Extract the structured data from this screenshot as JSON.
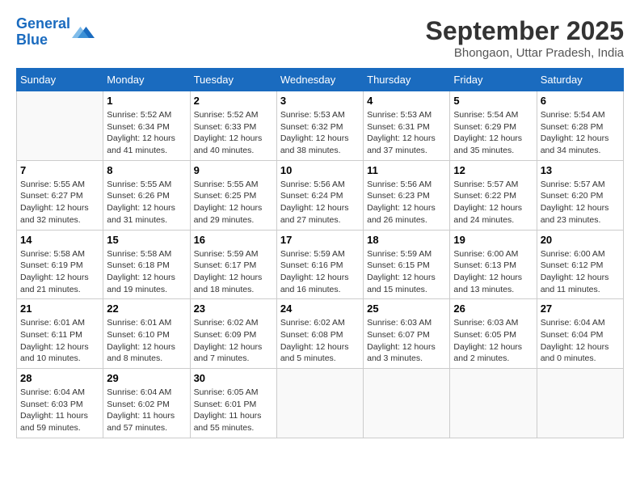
{
  "header": {
    "logo_line1": "General",
    "logo_line2": "Blue",
    "month": "September 2025",
    "location": "Bhongaon, Uttar Pradesh, India"
  },
  "days_of_week": [
    "Sunday",
    "Monday",
    "Tuesday",
    "Wednesday",
    "Thursday",
    "Friday",
    "Saturday"
  ],
  "weeks": [
    [
      {
        "day": "",
        "info": ""
      },
      {
        "day": "1",
        "info": "Sunrise: 5:52 AM\nSunset: 6:34 PM\nDaylight: 12 hours\nand 41 minutes."
      },
      {
        "day": "2",
        "info": "Sunrise: 5:52 AM\nSunset: 6:33 PM\nDaylight: 12 hours\nand 40 minutes."
      },
      {
        "day": "3",
        "info": "Sunrise: 5:53 AM\nSunset: 6:32 PM\nDaylight: 12 hours\nand 38 minutes."
      },
      {
        "day": "4",
        "info": "Sunrise: 5:53 AM\nSunset: 6:31 PM\nDaylight: 12 hours\nand 37 minutes."
      },
      {
        "day": "5",
        "info": "Sunrise: 5:54 AM\nSunset: 6:29 PM\nDaylight: 12 hours\nand 35 minutes."
      },
      {
        "day": "6",
        "info": "Sunrise: 5:54 AM\nSunset: 6:28 PM\nDaylight: 12 hours\nand 34 minutes."
      }
    ],
    [
      {
        "day": "7",
        "info": "Sunrise: 5:55 AM\nSunset: 6:27 PM\nDaylight: 12 hours\nand 32 minutes."
      },
      {
        "day": "8",
        "info": "Sunrise: 5:55 AM\nSunset: 6:26 PM\nDaylight: 12 hours\nand 31 minutes."
      },
      {
        "day": "9",
        "info": "Sunrise: 5:55 AM\nSunset: 6:25 PM\nDaylight: 12 hours\nand 29 minutes."
      },
      {
        "day": "10",
        "info": "Sunrise: 5:56 AM\nSunset: 6:24 PM\nDaylight: 12 hours\nand 27 minutes."
      },
      {
        "day": "11",
        "info": "Sunrise: 5:56 AM\nSunset: 6:23 PM\nDaylight: 12 hours\nand 26 minutes."
      },
      {
        "day": "12",
        "info": "Sunrise: 5:57 AM\nSunset: 6:22 PM\nDaylight: 12 hours\nand 24 minutes."
      },
      {
        "day": "13",
        "info": "Sunrise: 5:57 AM\nSunset: 6:20 PM\nDaylight: 12 hours\nand 23 minutes."
      }
    ],
    [
      {
        "day": "14",
        "info": "Sunrise: 5:58 AM\nSunset: 6:19 PM\nDaylight: 12 hours\nand 21 minutes."
      },
      {
        "day": "15",
        "info": "Sunrise: 5:58 AM\nSunset: 6:18 PM\nDaylight: 12 hours\nand 19 minutes."
      },
      {
        "day": "16",
        "info": "Sunrise: 5:59 AM\nSunset: 6:17 PM\nDaylight: 12 hours\nand 18 minutes."
      },
      {
        "day": "17",
        "info": "Sunrise: 5:59 AM\nSunset: 6:16 PM\nDaylight: 12 hours\nand 16 minutes."
      },
      {
        "day": "18",
        "info": "Sunrise: 5:59 AM\nSunset: 6:15 PM\nDaylight: 12 hours\nand 15 minutes."
      },
      {
        "day": "19",
        "info": "Sunrise: 6:00 AM\nSunset: 6:13 PM\nDaylight: 12 hours\nand 13 minutes."
      },
      {
        "day": "20",
        "info": "Sunrise: 6:00 AM\nSunset: 6:12 PM\nDaylight: 12 hours\nand 11 minutes."
      }
    ],
    [
      {
        "day": "21",
        "info": "Sunrise: 6:01 AM\nSunset: 6:11 PM\nDaylight: 12 hours\nand 10 minutes."
      },
      {
        "day": "22",
        "info": "Sunrise: 6:01 AM\nSunset: 6:10 PM\nDaylight: 12 hours\nand 8 minutes."
      },
      {
        "day": "23",
        "info": "Sunrise: 6:02 AM\nSunset: 6:09 PM\nDaylight: 12 hours\nand 7 minutes."
      },
      {
        "day": "24",
        "info": "Sunrise: 6:02 AM\nSunset: 6:08 PM\nDaylight: 12 hours\nand 5 minutes."
      },
      {
        "day": "25",
        "info": "Sunrise: 6:03 AM\nSunset: 6:07 PM\nDaylight: 12 hours\nand 3 minutes."
      },
      {
        "day": "26",
        "info": "Sunrise: 6:03 AM\nSunset: 6:05 PM\nDaylight: 12 hours\nand 2 minutes."
      },
      {
        "day": "27",
        "info": "Sunrise: 6:04 AM\nSunset: 6:04 PM\nDaylight: 12 hours\nand 0 minutes."
      }
    ],
    [
      {
        "day": "28",
        "info": "Sunrise: 6:04 AM\nSunset: 6:03 PM\nDaylight: 11 hours\nand 59 minutes."
      },
      {
        "day": "29",
        "info": "Sunrise: 6:04 AM\nSunset: 6:02 PM\nDaylight: 11 hours\nand 57 minutes."
      },
      {
        "day": "30",
        "info": "Sunrise: 6:05 AM\nSunset: 6:01 PM\nDaylight: 11 hours\nand 55 minutes."
      },
      {
        "day": "",
        "info": ""
      },
      {
        "day": "",
        "info": ""
      },
      {
        "day": "",
        "info": ""
      },
      {
        "day": "",
        "info": ""
      }
    ]
  ]
}
